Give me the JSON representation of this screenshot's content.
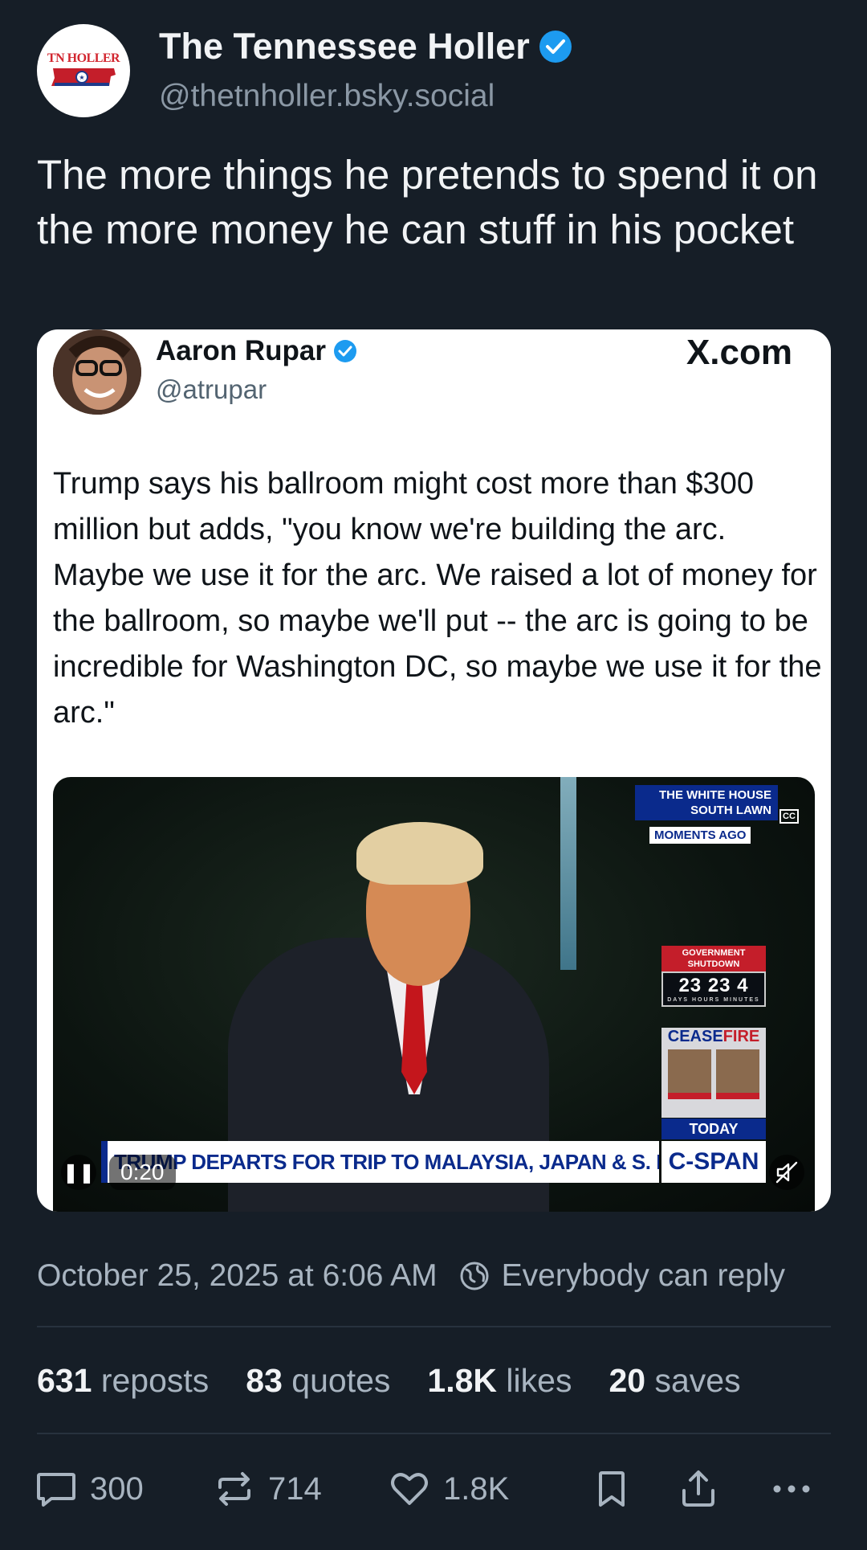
{
  "author": {
    "display_name": "The Tennessee Holler",
    "handle": "@thetnholler.bsky.social",
    "avatar_logo_text": "TN HOLLER",
    "verified_color": "#1d9bf0"
  },
  "post_text": "The more things he pretends to spend it on the more money he can stuff in his pocket",
  "embed": {
    "name": "Aaron Rupar",
    "handle": "@atrupar",
    "source": "X.com",
    "text": "Trump says his ballroom might cost more than $300 million but adds, \"you know we're building the arc. Maybe we use it for the arc. We raised a lot of money for the ballroom, so maybe we'll put -- the arc is going to be incredible for Washington DC, so maybe we use it for the arc.\"",
    "video": {
      "location": "THE WHITE HOUSE SOUTH LAWN",
      "moments_ago": "MOMENTS AGO",
      "cc": "CC",
      "gov_title": "GOVERNMENT SHUTDOWN",
      "gov_count": "23 23 4",
      "gov_units": "DAYS HOURS MINUTES",
      "cease_prefix": "CEASE",
      "cease_suffix": "FIRE",
      "today": "TODAY",
      "chyron": "TRUMP DEPARTS FOR TRIP TO MALAYSIA, JAPAN & S. KOREA",
      "network": "C-SPAN",
      "timecode": "0:20",
      "pause_glyph": "❚❚"
    }
  },
  "meta": {
    "timestamp": "October 25, 2025 at 6:06 AM",
    "reply_setting": "Everybody can reply"
  },
  "stats": {
    "reposts_count": "631",
    "reposts_label": "reposts",
    "quotes_count": "83",
    "quotes_label": "quotes",
    "likes_count": "1.8K",
    "likes_label": "likes",
    "saves_count": "20",
    "saves_label": "saves"
  },
  "actions": {
    "replies": "300",
    "reposts": "714",
    "likes": "1.8K"
  }
}
